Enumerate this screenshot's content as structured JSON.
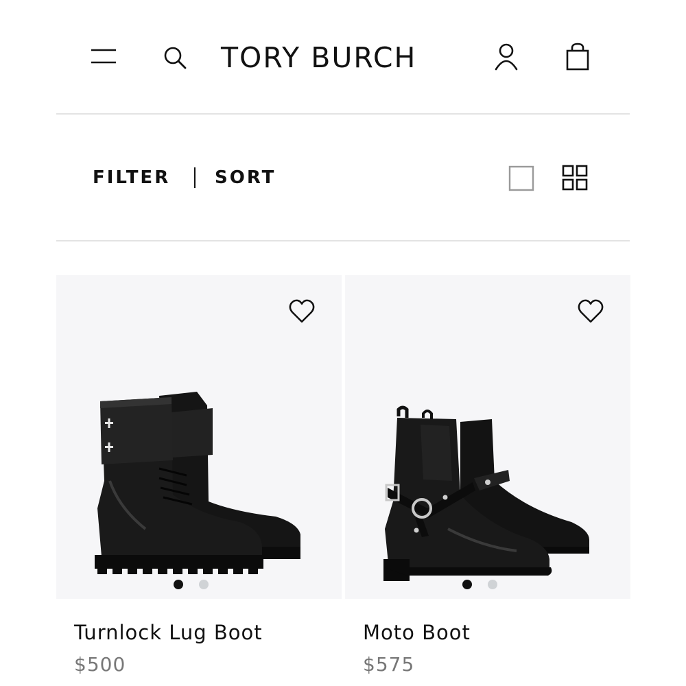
{
  "header": {
    "brand": "TORY BURCH",
    "icons": [
      "menu-icon",
      "search-icon",
      "account-icon",
      "shopping-bag-icon"
    ]
  },
  "toolbar": {
    "filter_label": "FILTER",
    "sort_label": "SORT",
    "view_icons": [
      "single-column-view-icon",
      "grid-view-icon"
    ]
  },
  "products": [
    {
      "name": "Turnlock Lug Boot",
      "price": "$500",
      "image_slides": 2,
      "active_slide": 1,
      "icon": "heart-icon"
    },
    {
      "name": "Moto Boot",
      "price": "$575",
      "image_slides": 2,
      "active_slide": 1,
      "icon": "heart-icon"
    }
  ],
  "colors": {
    "text": "#111111",
    "price": "#777777",
    "image_bg": "#f6f6f8",
    "divider": "#e3e3e3",
    "dot_active": "#111111",
    "dot_inactive": "#d0d3d6"
  }
}
